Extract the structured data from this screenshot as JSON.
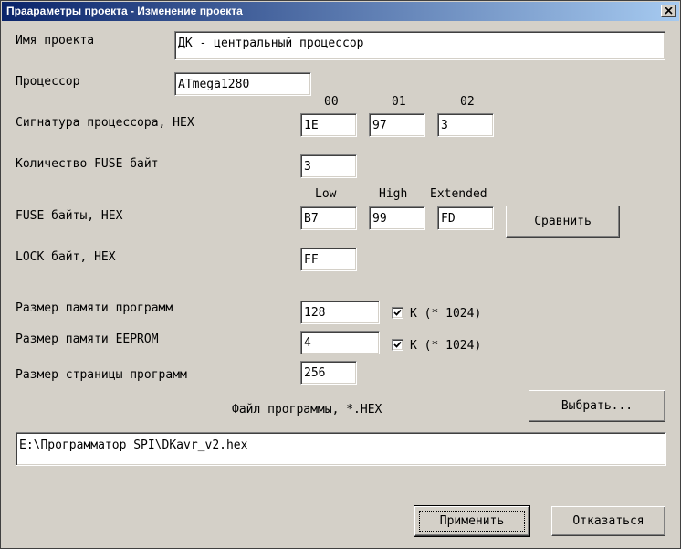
{
  "window": {
    "title": "Праараметры проекта - Изменение проекта"
  },
  "labels": {
    "project_name": "Имя проекта",
    "processor": "Процессор",
    "signature": "Сигнатура процессора, HEX",
    "fuse_count": "Количество FUSE байт",
    "fuse_bytes": "FUSE байты, HEX",
    "lock_byte": "LOCK байт, HEX",
    "flash_size": "Размер памяти программ",
    "eeprom_size": "Размер памяти EEPROM",
    "page_size": "Размер страницы программ",
    "program_file": "Файл программы, *.HEX"
  },
  "signature_columns": [
    "00",
    "01",
    "02"
  ],
  "fuse_columns": [
    "Low",
    "High",
    "Extended"
  ],
  "fields": {
    "project_name": "ДК - центральный процессор",
    "processor": "ATmega1280",
    "signature": [
      "1E",
      "97",
      "3"
    ],
    "fuse_count": "3",
    "fuse_bytes": [
      "B7",
      "99",
      "FD"
    ],
    "lock_byte": "FF",
    "flash_size": "128",
    "eeprom_size": "4",
    "page_size": "256",
    "program_file_path": "E:\\Программатор SPI\\DKavr_v2.hex"
  },
  "checkboxes": {
    "flash_k": {
      "label": "K (* 1024)",
      "checked": true
    },
    "eeprom_k": {
      "label": "K (* 1024)",
      "checked": true
    }
  },
  "buttons": {
    "compare": "Сравнить",
    "browse": "Выбрать...",
    "apply": "Применить",
    "cancel": "Отказаться"
  }
}
